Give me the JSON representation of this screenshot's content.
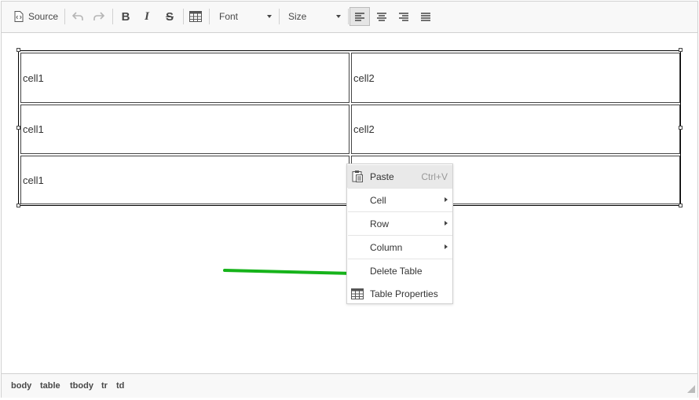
{
  "toolbar": {
    "source_label": "Source",
    "bold_label": "B",
    "italic_label": "I",
    "strike_label": "S",
    "font_label": "Font",
    "size_label": "Size"
  },
  "table": {
    "rows": [
      [
        "cell1",
        "cell2"
      ],
      [
        "cell1",
        "cell2"
      ],
      [
        "cell1",
        ""
      ]
    ]
  },
  "context_menu": {
    "paste": {
      "label": "Paste",
      "shortcut": "Ctrl+V"
    },
    "cell": {
      "label": "Cell"
    },
    "row": {
      "label": "Row"
    },
    "column": {
      "label": "Column"
    },
    "delete_table": {
      "label": "Delete Table"
    },
    "table_properties": {
      "label": "Table Properties"
    }
  },
  "elements_path": [
    "body",
    "table",
    "tbody",
    "tr",
    "td"
  ],
  "annotation": {
    "arrow_color": "#16b31a"
  }
}
